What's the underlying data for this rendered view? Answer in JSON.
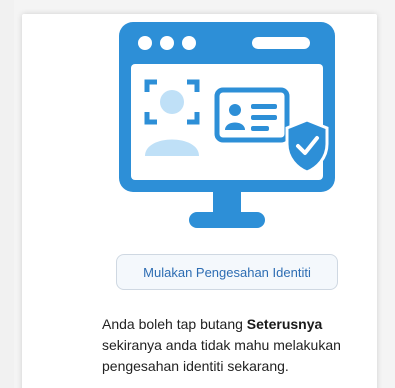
{
  "colors": {
    "accent_blue": "#2d8fd7",
    "light_blue": "#bfe0f7",
    "button_text": "#2d6db3"
  },
  "illustration": {
    "icons": [
      "monitor-icon",
      "face-scan-icon",
      "id-card-icon",
      "shield-check-icon"
    ]
  },
  "actions": {
    "start_verification_label": "Mulakan Pengesahan Identiti"
  },
  "info": {
    "text_before": "Anda boleh tap butang ",
    "bold_word": "Seterusnya",
    "text_after": " sekiranya anda tidak mahu melakukan pengesahan identiti sekarang."
  }
}
